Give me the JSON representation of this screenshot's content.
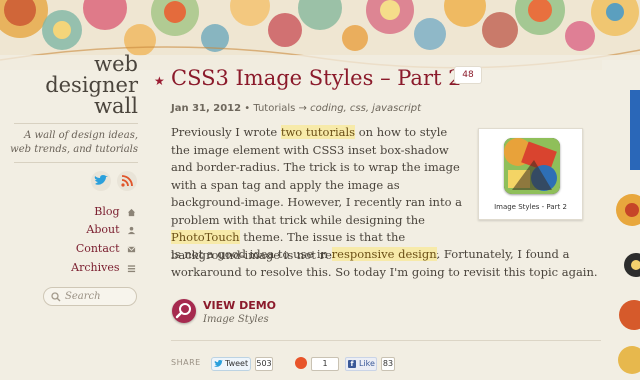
{
  "site": {
    "logo_lines": [
      "web",
      "designer",
      "wall"
    ],
    "tagline": "A wall of design ideas, web trends, and tutorials"
  },
  "sidebar": {
    "social": [
      {
        "icon": "twitter-icon",
        "color": "#2ba0dc"
      },
      {
        "icon": "rss-icon",
        "color": "#e0552b"
      }
    ],
    "nav": [
      {
        "label": "Blog",
        "icon": "home-icon"
      },
      {
        "label": "About",
        "icon": "person-icon"
      },
      {
        "label": "Contact",
        "icon": "mail-icon"
      },
      {
        "label": "Archives",
        "icon": "list-icon"
      }
    ],
    "search_placeholder": "Search"
  },
  "article": {
    "title": "CSS3 Image Styles – Part 2",
    "comment_count": "48",
    "date": "Jan 31, 2012",
    "category": "Tutorials",
    "arrow": "→",
    "tags": "coding, css, javascript",
    "p1_a": "Previously I wrote ",
    "p1_link1": "two tutorials",
    "p1_b": " on how to style the image element with CSS3 inset box-shadow and border-radius. The trick is to wrap the image with a span tag and apply the image as background-image. However, I recently ran into a problem with that trick while designing the ",
    "p1_link2": "PhotoTouch",
    "p1_c": " theme. The issue is that the background-image is not resizable and thus it",
    "p2_a": "is not a good idea to use in ",
    "p2_link": "responsive design",
    "p2_b": ". Fortunately, I found a workaround to resolve this. So today I'm going to revisit this topic again.",
    "thumb_caption": "Image Styles - Part 2",
    "demo_label": "VIEW DEMO",
    "demo_sub": "Image Styles"
  },
  "share": {
    "label": "SHARE",
    "tweet_label": "Tweet",
    "tweet_count": "503",
    "su_count": "1",
    "like_label": "Like",
    "like_count": "83"
  },
  "colors": {
    "accent": "#8b1a2b",
    "highlight": "#f7eaa9",
    "background": "#f2eee3"
  }
}
